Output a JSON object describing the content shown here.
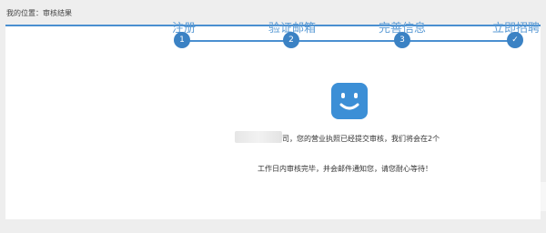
{
  "breadcrumb": {
    "prefix": "我的位置：",
    "current": "审核结果"
  },
  "steps": [
    {
      "label": "注册",
      "marker": "1"
    },
    {
      "label": "验证邮箱",
      "marker": "2"
    },
    {
      "label": "完善信息",
      "marker": "3"
    },
    {
      "label": "立即招聘",
      "marker": "✓"
    }
  ],
  "result": {
    "icon": "smiley-icon",
    "line1": "司，您的营业执照已经提交审核，我们将会在2个",
    "line2": "工作日内审核完毕，并会邮件通知您，请您耐心等待！"
  },
  "colors": {
    "accent": "#3b82c4",
    "panel": "#ffffff",
    "background": "#eeeeee"
  }
}
